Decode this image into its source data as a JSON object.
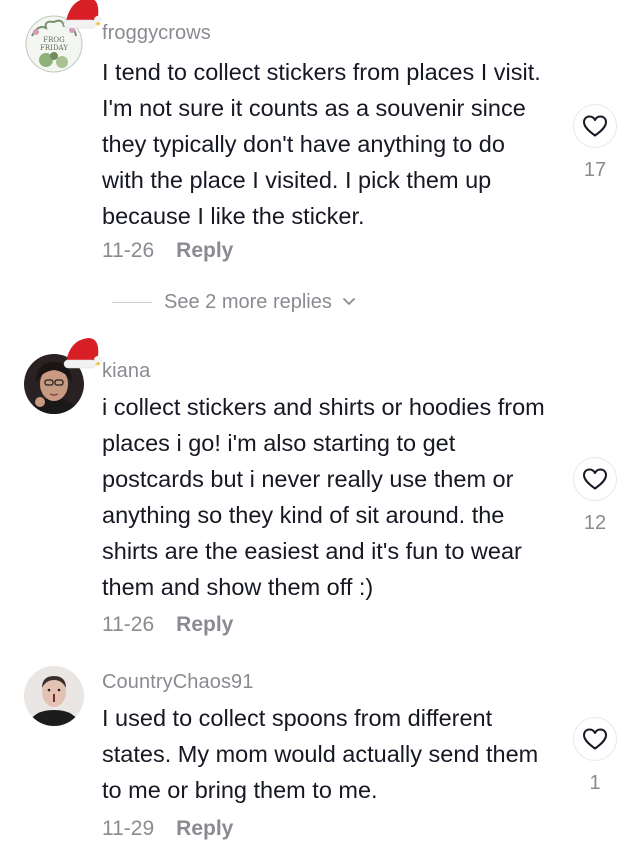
{
  "comments": [
    {
      "username": "froggycrows",
      "text": "I tend to collect stickers from places I visit. I'm not sure it counts as a souvenir since they typically don't have anything to do with the place I visited. I pick them up because I like the sticker.",
      "date": "11-26",
      "reply_label": "Reply",
      "likes": "17",
      "avatar_text": "FROG FRIDAY"
    },
    {
      "username": "kiana",
      "text": "i collect stickers and shirts or hoodies from places i go! i'm also starting to get postcards but i never really use them or anything so they kind of sit around. the shirts are the easiest and it's fun to wear them and show them off :)",
      "date": "11-26",
      "reply_label": "Reply",
      "likes": "12"
    },
    {
      "username": "CountryChaos91",
      "text": "I used to collect spoons from different states. My mom would actually send them to me or bring them to me.",
      "date": "11-29",
      "reply_label": "Reply",
      "likes": "1"
    }
  ],
  "more_replies_label": "See 2 more replies",
  "icons": {
    "like": "heart-outline-icon",
    "expand": "chevron-down-icon",
    "hat": "santa-hat-icon"
  },
  "colors": {
    "text": "#161823",
    "secondary": "#8a8b91",
    "hat_red": "#d81f26"
  }
}
